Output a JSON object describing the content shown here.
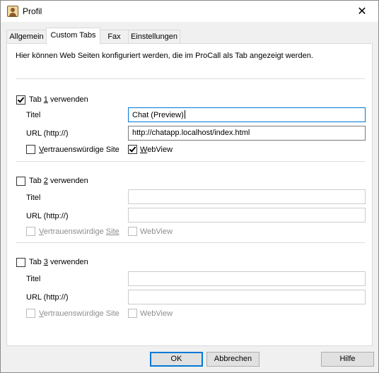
{
  "window": {
    "title": "Profil",
    "close_glyph": "✕"
  },
  "tabs": [
    {
      "label": "Allgemein"
    },
    {
      "label": "Custom Tabs",
      "active": true
    },
    {
      "label": "Fax"
    },
    {
      "label": "Einstellungen"
    }
  ],
  "description": "Hier können Web Seiten konfiguriert werden, die im ProCall als Tab angezeigt werden.",
  "sections": [
    {
      "use_prefix": "Tab ",
      "use_number": "1",
      "use_suffix": " verwenden",
      "use_checked": true,
      "title_label": "Titel",
      "title_value": "Chat (Preview)",
      "url_label": "URL (http://)",
      "url_value": "http://chatapp.localhost/index.html",
      "trusted_label_u": "V",
      "trusted_label_rest": "ertrauenswürdige Site",
      "trusted_checked": false,
      "webview_label_u": "W",
      "webview_label_rest": "ebView",
      "webview_checked": true,
      "enabled": true
    },
    {
      "use_prefix": "Tab ",
      "use_number": "2",
      "use_suffix": " verwenden",
      "use_checked": false,
      "title_label": "Titel",
      "title_value": "",
      "url_label": "URL (http://)",
      "url_value": "",
      "trusted_label_u": "V",
      "trusted_label_rest": "ertrauenswürdige ",
      "trusted_label_tail": "Site",
      "trusted_checked": false,
      "webview_label": "WebView",
      "webview_checked": false,
      "enabled": false
    },
    {
      "use_prefix": "Tab ",
      "use_number": "3",
      "use_suffix": " verwenden",
      "use_checked": false,
      "title_label": "Titel",
      "title_value": "",
      "url_label": "URL (http://)",
      "url_value": "",
      "trusted_label_u": "V",
      "trusted_label_rest": "ertrauenswürdige Site",
      "trusted_checked": false,
      "webview_label": "WebView",
      "webview_checked": false,
      "enabled": false
    }
  ],
  "buttons": {
    "ok": "OK",
    "cancel": "Abbrechen",
    "help": "Hilfe"
  },
  "colors": {
    "focus_border": "#0078d7",
    "disabled_text": "#8d8d8d"
  }
}
